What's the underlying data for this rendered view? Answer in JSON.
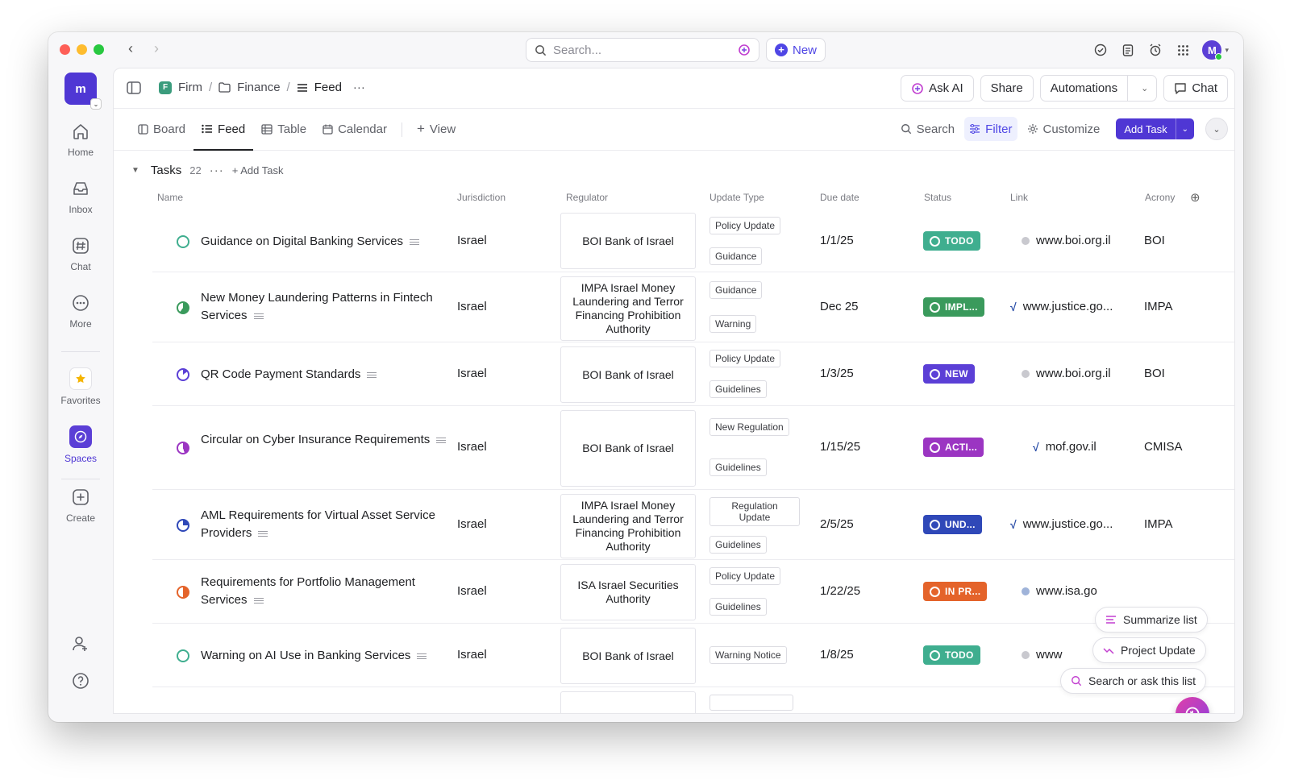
{
  "topbar": {
    "search_placeholder": "Search...",
    "new_label": "New",
    "avatar_initial": "M"
  },
  "rail": {
    "workspace_initial": "m",
    "items": [
      {
        "label": "Home"
      },
      {
        "label": "Inbox"
      },
      {
        "label": "Chat"
      },
      {
        "label": "More"
      },
      {
        "label": "Favorites"
      },
      {
        "label": "Spaces"
      },
      {
        "label": "Create"
      }
    ]
  },
  "breadcrumb": {
    "workspace_badge": "F",
    "workspace": "Firm",
    "folder": "Finance",
    "list": "Feed",
    "more": "···"
  },
  "header_actions": {
    "ask_ai": "Ask AI",
    "share": "Share",
    "automations": "Automations",
    "chat": "Chat"
  },
  "views": {
    "tabs": [
      "Board",
      "Feed",
      "Table",
      "Calendar"
    ],
    "active": "Feed",
    "add_view": "View"
  },
  "tools": {
    "search": "Search",
    "filter": "Filter",
    "customize": "Customize",
    "add_task": "Add Task"
  },
  "group": {
    "name": "Tasks",
    "count": "22",
    "add_task": "Add Task"
  },
  "columns": [
    "Name",
    "Jurisdiction",
    "Regulator",
    "Update Type",
    "Due date",
    "Status",
    "Link",
    "Acrony"
  ],
  "colors": {
    "accent": "#4f37d4",
    "todo": "#3fae8f",
    "impl": "#3a9a5c",
    "new": "#5b3fd6",
    "acti": "#9b35c2",
    "und": "#2f48b8",
    "inpr": "#e4632a"
  },
  "rows": [
    {
      "name": "Guidance on Digital Banking Services",
      "jurisdiction": "Israel",
      "regulator": "BOI Bank of Israel",
      "tags": [
        "Policy Update",
        "Guidance"
      ],
      "due": "1/1/25",
      "status": "TODO",
      "link": "www.boi.org.il",
      "acronym": "BOI"
    },
    {
      "name": "New Money Laundering Patterns in Fintech Services",
      "jurisdiction": "Israel",
      "regulator": "IMPA Israel Money Laundering and Terror Financing Prohibition Authority",
      "tags": [
        "Guidance",
        "Warning"
      ],
      "due": "Dec 25",
      "status": "IMPL...",
      "link": "www.justice.go...",
      "acronym": "IMPA"
    },
    {
      "name": "QR Code Payment Standards",
      "jurisdiction": "Israel",
      "regulator": "BOI Bank of Israel",
      "tags": [
        "Policy Update",
        "Guidelines"
      ],
      "due": "1/3/25",
      "status": "NEW",
      "link": "www.boi.org.il",
      "acronym": "BOI"
    },
    {
      "name": "Circular on Cyber Insurance Requirements",
      "jurisdiction": "Israel",
      "regulator": "BOI Bank of Israel",
      "tags": [
        "New Regulation",
        "Guidelines"
      ],
      "due": "1/15/25",
      "status": "ACTI...",
      "link": "mof.gov.il",
      "acronym": "CMISA"
    },
    {
      "name": "AML Requirements for Virtual Asset Service Providers",
      "jurisdiction": "Israel",
      "regulator": "IMPA Israel Money Laundering and Terror Financing Prohibition Authority",
      "tags": [
        "Regulation Update",
        "Guidelines"
      ],
      "due": "2/5/25",
      "status": "UND...",
      "link": "www.justice.go...",
      "acronym": "IMPA"
    },
    {
      "name": "Requirements for Portfolio Management Services",
      "jurisdiction": "Israel",
      "regulator": "ISA Israel Securities Authority",
      "tags": [
        "Policy Update",
        "Guidelines"
      ],
      "due": "1/22/25",
      "status": "IN PR...",
      "link": "www.isa.go",
      "acronym": ""
    },
    {
      "name": "Warning on AI Use in Banking Services",
      "jurisdiction": "Israel",
      "regulator": "BOI Bank of Israel",
      "tags": [
        "Warning Notice"
      ],
      "due": "1/8/25",
      "status": "TODO",
      "link": "www",
      "acronym": ""
    }
  ],
  "floating": {
    "summarize": "Summarize list",
    "project_update": "Project Update",
    "search_ask": "Search or ask this list"
  }
}
